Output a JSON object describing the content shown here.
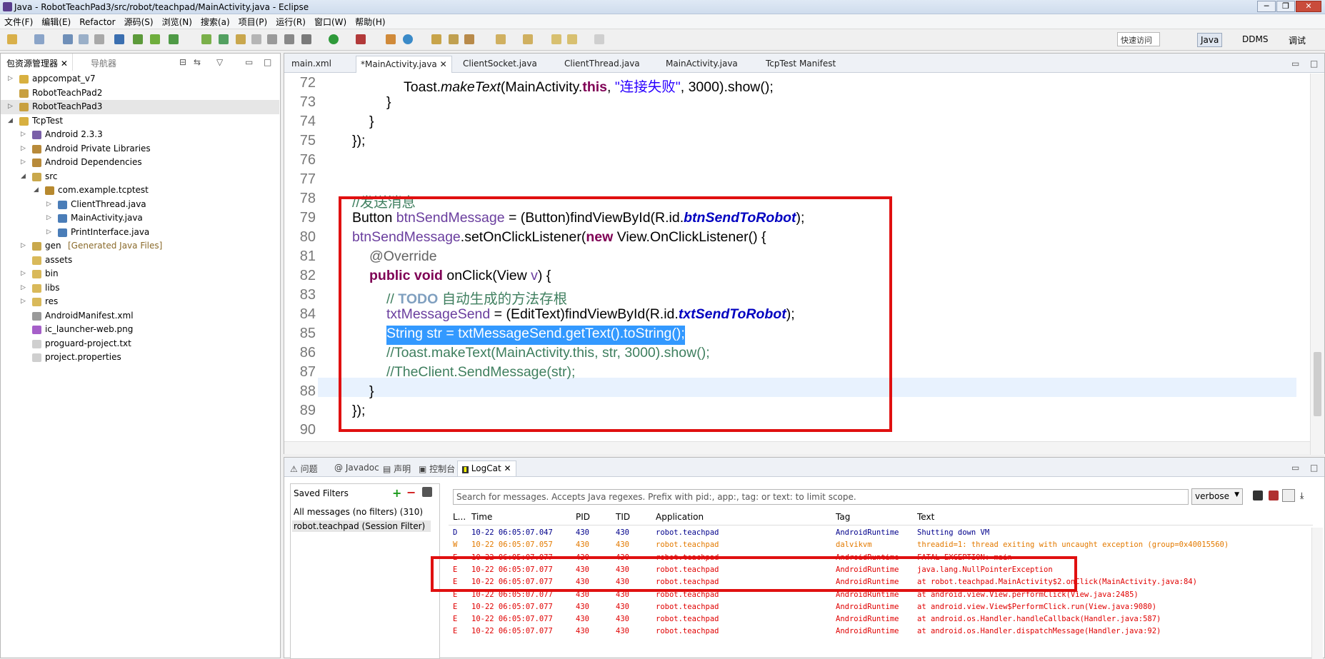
{
  "window": {
    "title": "Java  -  RobotTeachPad3/src/robot/teachpad/MainActivity.java  -  Eclipse"
  },
  "menu": [
    "文件(F)",
    "编辑(E)",
    "Refactor",
    "源码(S)",
    "浏览(N)",
    "搜索(a)",
    "项目(P)",
    "运行(R)",
    "窗口(W)",
    "帮助(H)"
  ],
  "quick_access": "快速访问",
  "perspectives": [
    "Java",
    "DDMS",
    "调试"
  ],
  "package_explorer": {
    "tab_label": "包资源管理器",
    "nav_tab_label": "导航器",
    "items": [
      {
        "label": "appcompat_v7",
        "depth": 0,
        "tw": "▷"
      },
      {
        "label": "RobotTeachPad2",
        "depth": 0,
        "tw": ""
      },
      {
        "label": "RobotTeachPad3",
        "depth": 0,
        "tw": "▷"
      },
      {
        "label": "TcpTest",
        "depth": 0,
        "tw": "◢"
      },
      {
        "label": "Android 2.3.3",
        "depth": 1,
        "tw": "▷"
      },
      {
        "label": "Android Private Libraries",
        "depth": 1,
        "tw": "▷"
      },
      {
        "label": "Android Dependencies",
        "depth": 1,
        "tw": "▷"
      },
      {
        "label": "src",
        "depth": 1,
        "tw": "◢"
      },
      {
        "label": "com.example.tcptest",
        "depth": 2,
        "tw": "◢"
      },
      {
        "label": "ClientThread.java",
        "depth": 3,
        "tw": "▷"
      },
      {
        "label": "MainActivity.java",
        "depth": 3,
        "tw": "▷"
      },
      {
        "label": "PrintInterface.java",
        "depth": 3,
        "tw": "▷"
      },
      {
        "label": "gen",
        "suffix": "[Generated Java Files]",
        "depth": 1,
        "tw": "▷"
      },
      {
        "label": "assets",
        "depth": 1,
        "tw": ""
      },
      {
        "label": "bin",
        "depth": 1,
        "tw": "▷"
      },
      {
        "label": "libs",
        "depth": 1,
        "tw": "▷"
      },
      {
        "label": "res",
        "depth": 1,
        "tw": "▷"
      },
      {
        "label": "AndroidManifest.xml",
        "depth": 1,
        "tw": ""
      },
      {
        "label": "ic_launcher-web.png",
        "depth": 1,
        "tw": ""
      },
      {
        "label": "proguard-project.txt",
        "depth": 1,
        "tw": ""
      },
      {
        "label": "project.properties",
        "depth": 1,
        "tw": ""
      }
    ]
  },
  "editor": {
    "tabs": [
      "main.xml",
      "*MainActivity.java",
      "ClientSocket.java",
      "ClientThread.java",
      "MainActivity.java",
      "TcpTest Manifest"
    ],
    "line_numbers": [
      "72",
      "73",
      "74",
      "75",
      "76",
      "77",
      "78",
      "79",
      "80",
      "81",
      "82",
      "83",
      "84",
      "85",
      "86",
      "87",
      "88",
      "89",
      "90"
    ],
    "code": {
      "l72a": "Toast.",
      "l72b": "makeText",
      "l72c": "(MainActivity.",
      "l72d": "this",
      "l72e": ", ",
      "l72f": "\"连接失败\"",
      "l72g": ", 3000).show();",
      "l73": "}",
      "l74": "}",
      "l75": "});",
      "l78": "//发送消息",
      "l79a": "Button ",
      "l79b": "btnSendMessage",
      "l79c": " = (Button)findViewById(R.id.",
      "l79d": "btnSendToRobot",
      "l79e": ");",
      "l80a": "btnSendMessage",
      "l80b": ".setOnClickListener(",
      "l80c": "new",
      "l80d": " View.OnClickListener() {",
      "l81": "@Override",
      "l82a": "public",
      "l82b": " ",
      "l82c": "void",
      "l82d": " onClick(View ",
      "l82e": "v",
      "l82f": ") {",
      "l83a": "// ",
      "l83b": "TODO",
      "l83c": " 自动生成的方法存根",
      "l84a": "txtMessageSend",
      "l84b": " = (EditText)findViewById(R.id.",
      "l84c": "txtSendToRobot",
      "l84d": ");",
      "l85": "String str = txtMessageSend.getText().toString();",
      "l86": "//Toast.makeText(MainActivity.this, str, 3000).show();",
      "l87": "//TheClient.SendMessage(str);",
      "l88": "}",
      "l89": "});"
    }
  },
  "bottom": {
    "tabs": [
      "问题",
      "Javadoc",
      "声明",
      "控制台",
      "LogCat"
    ],
    "saved_filters": "Saved Filters",
    "filters": [
      "All messages (no filters) (310)",
      "robot.teachpad (Session Filter)"
    ],
    "search_placeholder": "Search for messages. Accepts Java regexes. Prefix with pid:, app:, tag: or text: to limit scope.",
    "verbose": "verbose",
    "columns": [
      "L...",
      "Time",
      "PID",
      "TID",
      "Application",
      "Tag",
      "Text"
    ],
    "rows": [
      {
        "l": "D",
        "time": "10-22 06:05:07.047",
        "pid": "430",
        "tid": "430",
        "app": "robot.teachpad",
        "tag": "AndroidRuntime",
        "text": "Shutting down VM"
      },
      {
        "l": "W",
        "time": "10-22 06:05:07.057",
        "pid": "430",
        "tid": "430",
        "app": "robot.teachpad",
        "tag": "dalvikvm",
        "text": "threadid=1: thread exiting with uncaught exception (group=0x40015560)"
      },
      {
        "l": "E",
        "time": "10-22 06:05:07.077",
        "pid": "430",
        "tid": "430",
        "app": "robot.teachpad",
        "tag": "AndroidRuntime",
        "text": "FATAL EXCEPTION: main"
      },
      {
        "l": "E",
        "time": "10-22 06:05:07.077",
        "pid": "430",
        "tid": "430",
        "app": "robot.teachpad",
        "tag": "AndroidRuntime",
        "text": "java.lang.NullPointerException"
      },
      {
        "l": "E",
        "time": "10-22 06:05:07.077",
        "pid": "430",
        "tid": "430",
        "app": "robot.teachpad",
        "tag": "AndroidRuntime",
        "text": "at robot.teachpad.MainActivity$2.onClick(MainActivity.java:84)"
      },
      {
        "l": "E",
        "time": "10-22 06:05:07.077",
        "pid": "430",
        "tid": "430",
        "app": "robot.teachpad",
        "tag": "AndroidRuntime",
        "text": "at android.view.View.performClick(View.java:2485)"
      },
      {
        "l": "E",
        "time": "10-22 06:05:07.077",
        "pid": "430",
        "tid": "430",
        "app": "robot.teachpad",
        "tag": "AndroidRuntime",
        "text": "at android.view.View$PerformClick.run(View.java:9080)"
      },
      {
        "l": "E",
        "time": "10-22 06:05:07.077",
        "pid": "430",
        "tid": "430",
        "app": "robot.teachpad",
        "tag": "AndroidRuntime",
        "text": "at android.os.Handler.handleCallback(Handler.java:587)"
      },
      {
        "l": "E",
        "time": "10-22 06:05:07.077",
        "pid": "430",
        "tid": "430",
        "app": "robot.teachpad",
        "tag": "AndroidRuntime",
        "text": "at android.os.Handler.dispatchMessage(Handler.java:92)"
      }
    ]
  }
}
